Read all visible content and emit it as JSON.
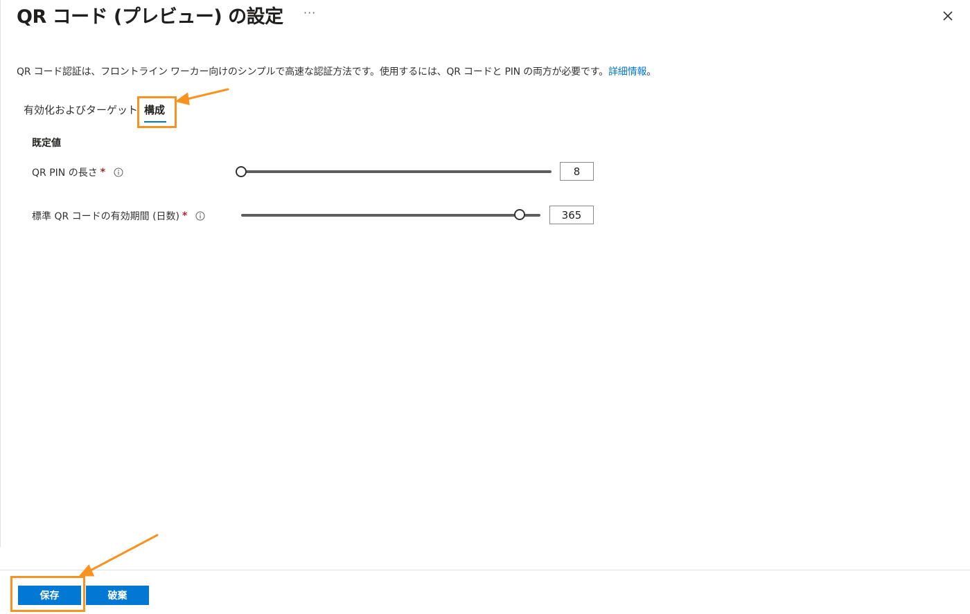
{
  "header": {
    "title": "QR コード (プレビュー) の設定",
    "more_label": "···"
  },
  "description": {
    "text": "QR コード認証は、フロントライン ワーカー向けのシンプルで高速な認証方法です。使用するには、QR コードと PIN の両方が必要です。",
    "link": "詳細情報",
    "suffix": "。"
  },
  "tabs": [
    {
      "label": "有効化およびターゲット",
      "selected": false
    },
    {
      "label": "構成",
      "selected": true
    }
  ],
  "section": {
    "title": "既定値"
  },
  "fields": {
    "pin_length": {
      "label": "QR PIN の長さ",
      "required_mark": "*",
      "value": "8",
      "slider_fraction": 0.0
    },
    "validity": {
      "label": "標準 QR コードの有効期間 (日数)",
      "required_mark": "*",
      "value": "365",
      "slider_fraction": 0.93
    }
  },
  "footer": {
    "save_label": "保存",
    "discard_label": "破棄"
  },
  "colors": {
    "accent": "#0078d4",
    "highlight": "#f7931e",
    "required": "#a4262c"
  }
}
